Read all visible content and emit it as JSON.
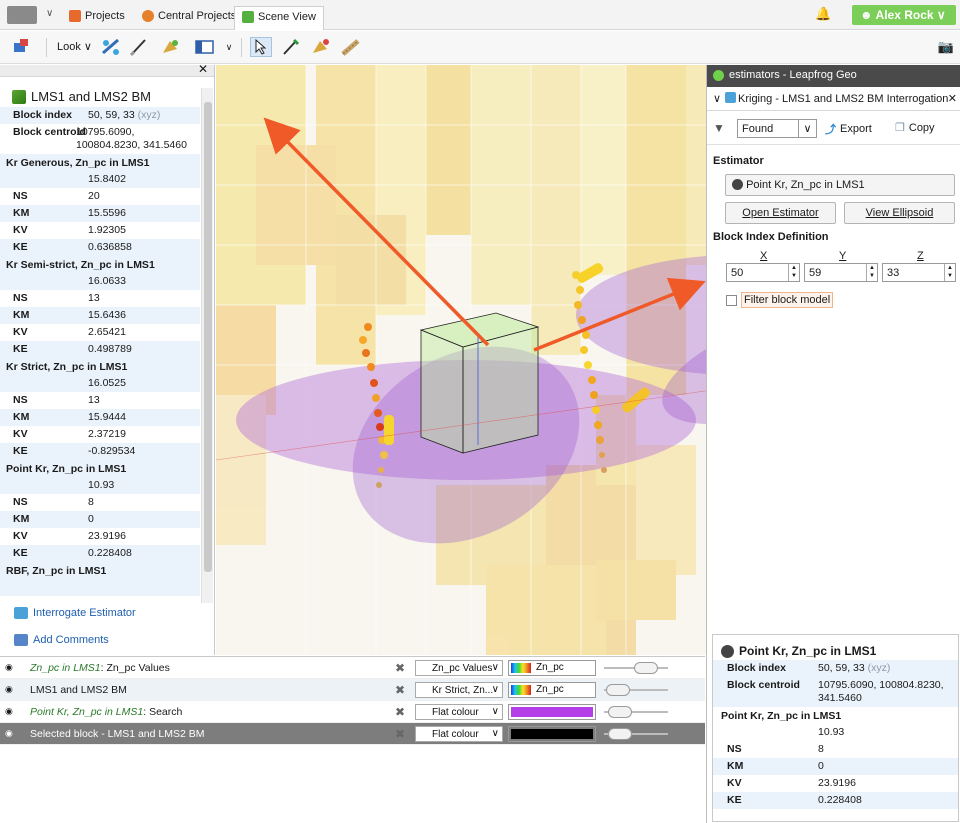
{
  "tabs": [
    {
      "label": "Projects",
      "active": false
    },
    {
      "label": "Central Projects",
      "active": false
    },
    {
      "label": "Scene View",
      "active": true
    }
  ],
  "user": {
    "name": "Alex Rock"
  },
  "toolbar": {
    "look_label": "Look"
  },
  "properties": {
    "title": "LMS1 and LMS2 BM",
    "block_index_label": "Block index",
    "block_index_value": "50, 59, 33",
    "block_index_suffix": "(xyz)",
    "block_centroid_label": "Block centroid",
    "block_centroid_line1": "10795.6090,",
    "block_centroid_line2": "100804.8230, 341.5460",
    "groups": [
      {
        "title": "Kr Generous, Zn_pc in LMS1",
        "value": "15.8402",
        "rows": [
          [
            "NS",
            "20"
          ],
          [
            "KM",
            "15.5596"
          ],
          [
            "KV",
            "1.92305"
          ],
          [
            "KE",
            "0.636858"
          ]
        ]
      },
      {
        "title": "Kr Semi-strict, Zn_pc in LMS1",
        "value": "16.0633",
        "rows": [
          [
            "NS",
            "13"
          ],
          [
            "KM",
            "15.6436"
          ],
          [
            "KV",
            "2.65421"
          ],
          [
            "KE",
            "0.498789"
          ]
        ]
      },
      {
        "title": "Kr Strict, Zn_pc in LMS1",
        "value": "16.0525",
        "rows": [
          [
            "NS",
            "13"
          ],
          [
            "KM",
            "15.9444"
          ],
          [
            "KV",
            "2.37219"
          ],
          [
            "KE",
            "-0.829534"
          ]
        ]
      },
      {
        "title": "Point Kr, Zn_pc in LMS1",
        "value": "10.93",
        "rows": [
          [
            "NS",
            "8"
          ],
          [
            "KM",
            "0"
          ],
          [
            "KV",
            "23.9196"
          ],
          [
            "KE",
            "0.228408"
          ]
        ]
      },
      {
        "title": "RBF, Zn_pc in LMS1",
        "value": "",
        "rows": []
      }
    ],
    "interrogate_link": "Interrogate Estimator",
    "comments_link": "Add Comments"
  },
  "layers": [
    {
      "name_italic": "Zn_pc in LMS1",
      "name_rest": ": Zn_pc Values",
      "dropdown": "Zn_pc Values",
      "swatch_label": "Zn_pc",
      "swatch_type": "gradient",
      "selected": false
    },
    {
      "name_italic": "",
      "name_rest": "LMS1 and LMS2 BM",
      "dropdown": "Kr Strict, Zn...",
      "swatch_label": "Zn_pc",
      "swatch_type": "gradient",
      "selected": false
    },
    {
      "name_italic": "Point Kr, Zn_pc in LMS1",
      "name_rest": ": Search",
      "dropdown": "Flat colour",
      "swatch_label": "",
      "swatch_type": "#b43ee8",
      "selected": false
    },
    {
      "name_italic": "",
      "name_rest": "Selected block - LMS1 and LMS2 BM",
      "dropdown": "Flat colour",
      "swatch_label": "",
      "swatch_type": "#000000",
      "selected": true
    }
  ],
  "estimator_window": {
    "title": "estimators - Leapfrog Geo",
    "tab_label": "Kriging - LMS1 and LMS2 BM Interrogation",
    "filter_value": "Found",
    "export_label": "Export",
    "copy_label": "Copy",
    "estimator_section": "Estimator",
    "estimator_button": "Point Kr, Zn_pc in LMS1",
    "open_estimator": "Open Estimator",
    "view_ellipsoid": "View Ellipsoid",
    "block_index_section": "Block Index Definition",
    "x_label": "X",
    "y_label": "Y",
    "z_label": "Z",
    "x_value": "50",
    "y_value": "59",
    "z_value": "33",
    "filter_checkbox": "Filter block model",
    "summary": {
      "title": "Point Kr, Zn_pc in LMS1",
      "block_index_label": "Block index",
      "block_index_value": "50, 59, 33",
      "block_index_suffix": "(xyz)",
      "block_centroid_label": "Block centroid",
      "block_centroid_value": "10795.6090, 100804.8230, 341.5460",
      "group_title": "Point Kr, Zn_pc in LMS1",
      "group_value": "10.93",
      "rows": [
        [
          "NS",
          "8"
        ],
        [
          "KM",
          "0"
        ],
        [
          "KV",
          "23.9196"
        ],
        [
          "KE",
          "0.228408"
        ]
      ]
    }
  },
  "colors": {
    "accent_green": "#7bcf59",
    "arrow": "#f05a28",
    "link": "#1e5fb0",
    "selection": "#eaf3fc"
  }
}
